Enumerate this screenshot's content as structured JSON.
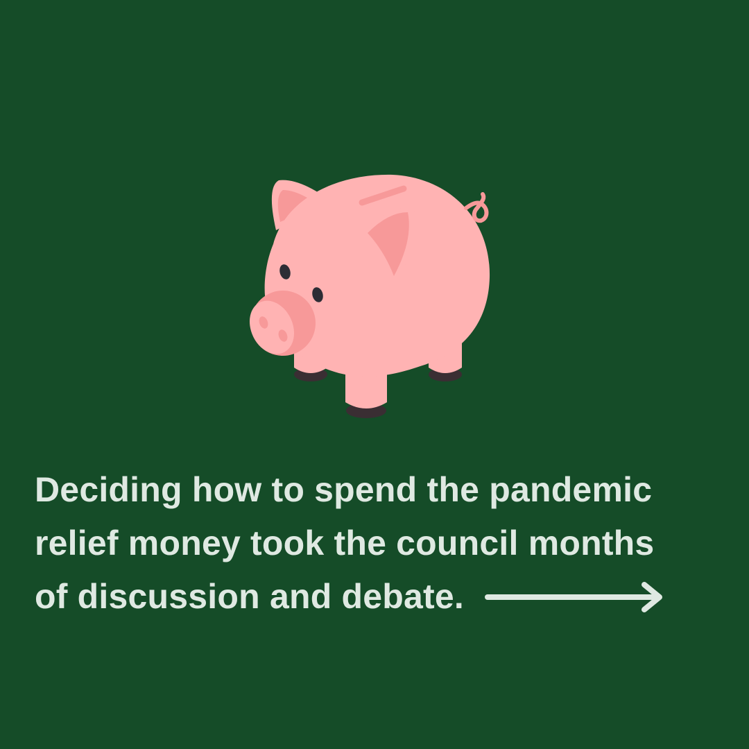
{
  "slide": {
    "background_color": "#154c28",
    "illustration": {
      "icon": "piggy-bank-icon",
      "body_color": "#ffb3b3",
      "shade_color": "#f79999",
      "eye_color": "#2d2d35"
    },
    "caption": {
      "lines": [
        "Deciding how to spend the pandemic",
        "relief money took the council months",
        "of discussion and debate."
      ],
      "text_color": "#dfe9e2"
    },
    "next_indicator": {
      "icon": "arrow-right-icon",
      "color": "#dfe9e2"
    }
  }
}
